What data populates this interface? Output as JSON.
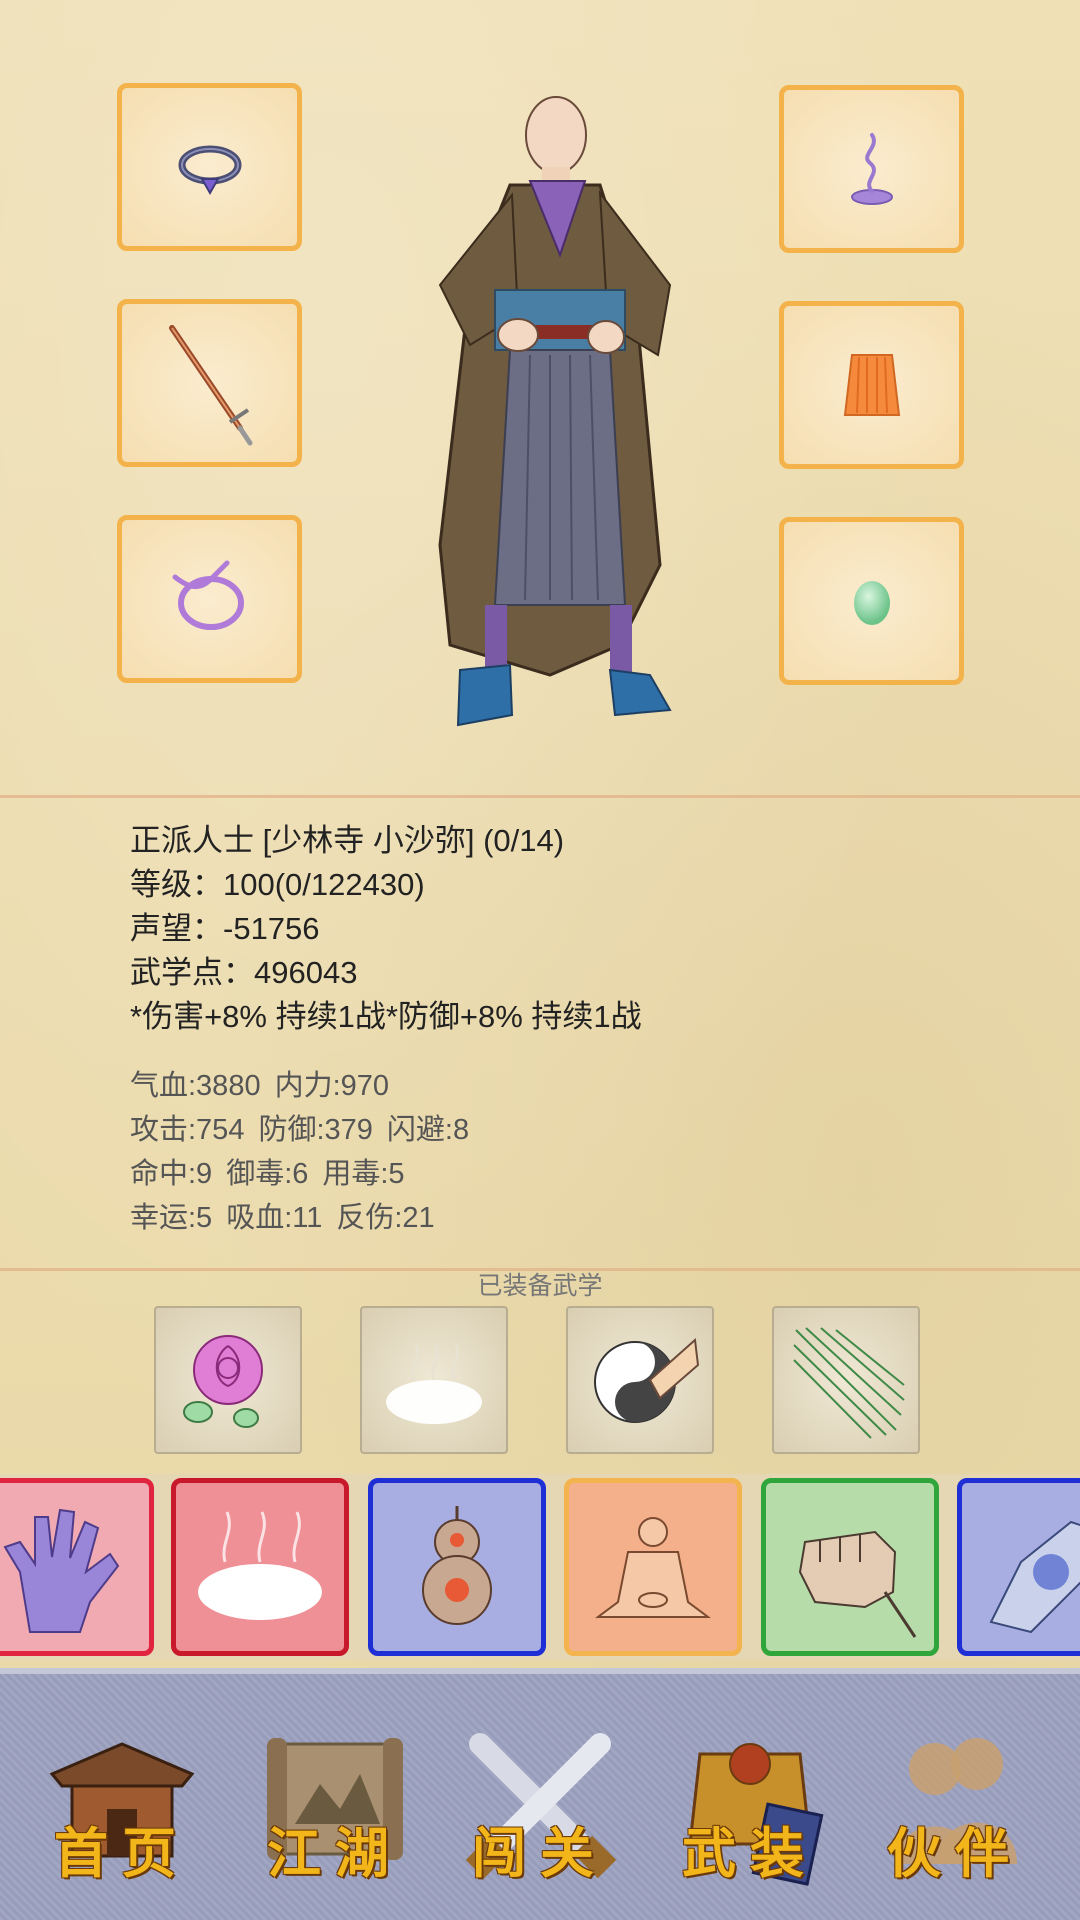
{
  "equipment": {
    "left": [
      {
        "slot": "accessory",
        "icon": "ring-icon"
      },
      {
        "slot": "weapon",
        "icon": "sword-icon"
      },
      {
        "slot": "charm",
        "icon": "cord-ring-icon"
      }
    ],
    "right": [
      {
        "slot": "headgear",
        "icon": "incense-icon"
      },
      {
        "slot": "armor",
        "icon": "skirt-icon"
      },
      {
        "slot": "gem",
        "icon": "jade-icon"
      }
    ]
  },
  "character": {
    "name_line": "正派人士 [少林寺 小沙弥] (0/14)",
    "level_line": "等级：100(0/122430)",
    "reputation_line": "声望：-51756",
    "martial_points_line": "武学点：496043",
    "buff_line": "*伤害+8% 持续1战*防御+8% 持续1战"
  },
  "stats": {
    "hp": "气血:3880",
    "mp": "内力:970",
    "attack": "攻击:754",
    "defense": "防御:379",
    "dodge": "闪避:8",
    "hit": "命中:9",
    "poison_resist": "御毒:6",
    "poison_use": "用毒:5",
    "luck": "幸运:5",
    "lifesteal": "吸血:11",
    "reflect": "反伤:21"
  },
  "equipped_martial": {
    "label": "已装备武学",
    "slots": [
      "rose-icon",
      "mist-icon",
      "taiji-palm-icon",
      "needles-icon"
    ]
  },
  "skill_bar": [
    {
      "icon": "palm-icon",
      "border": "#e0243f",
      "bg": "#f1aab2"
    },
    {
      "icon": "mist-icon",
      "border": "#c8192c",
      "bg": "#ef8f96"
    },
    {
      "icon": "gourd-icon",
      "border": "#1f2fd6",
      "bg": "#a9aee2"
    },
    {
      "icon": "meditation-icon",
      "border": "#f3b34f",
      "bg": "#f3b08a"
    },
    {
      "icon": "fist-icon",
      "border": "#2fa53c",
      "bg": "#b6dca9"
    },
    {
      "icon": "flower-hand-icon",
      "border": "#1f2fd6",
      "bg": "#a9aee2"
    }
  ],
  "nav": [
    {
      "label": "首页",
      "icon": "house-icon"
    },
    {
      "label": "江湖",
      "icon": "scroll-map-icon"
    },
    {
      "label": "闯关",
      "icon": "crossed-swords-icon"
    },
    {
      "label": "武装",
      "icon": "armor-book-icon"
    },
    {
      "label": "伙伴",
      "icon": "companions-icon"
    }
  ],
  "colors": {
    "slot_border": "#f4b24a",
    "nav_text": "#f2b51a",
    "navbar_bg": "#9ca1c0"
  }
}
